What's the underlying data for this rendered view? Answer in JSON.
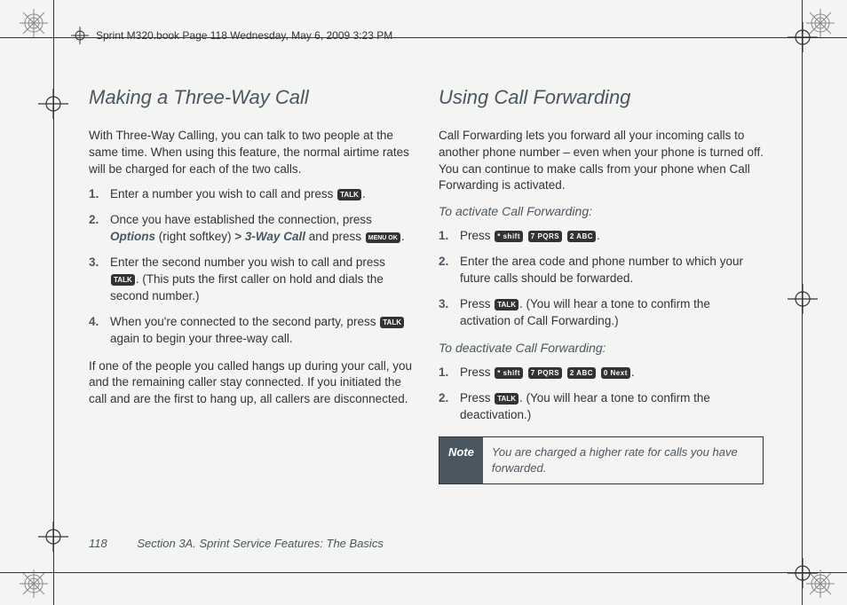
{
  "header_strip": "Sprint M320.book  Page 118  Wednesday, May 6, 2009  3:23 PM",
  "left": {
    "title": "Making a Three-Way Call",
    "intro": "With Three-Way Calling, you can talk to two people at the same time. When using this feature, the normal airtime rates will be charged for each of the two calls.",
    "step1_a": "Enter a number you wish to call and press ",
    "step1_b": ".",
    "step2_a": "Once you have established the connection, press ",
    "step2_options": "Options",
    "step2_b": " (right softkey) ",
    "step2_gt": ">",
    "step2_3way": " 3-Way Call",
    "step2_c": " and press ",
    "step2_d": ".",
    "step3_a": "Enter the second number you wish to call and press ",
    "step3_b": ". (This puts the first caller on hold and dials the second number.)",
    "step4_a": "When you're connected to the second party, press ",
    "step4_b": " again to begin your three-way call.",
    "outro": "If one of the people you called hangs up during your call, you and the remaining caller stay connected. If you initiated the call and are the first to hang up, all callers are disconnected."
  },
  "right": {
    "title": "Using Call Forwarding",
    "intro": "Call Forwarding lets you forward all your incoming calls to another phone number – even when your phone is turned off. You can continue to make calls from your phone when Call Forwarding is activated.",
    "activate_head": "To activate Call Forwarding:",
    "act1_a": "Press ",
    "act1_b": ".",
    "act2": "Enter the area code and phone number to which your future calls should be forwarded.",
    "act3_a": "Press ",
    "act3_b": ". (You will hear a tone to confirm the activation of Call Forwarding.)",
    "deactivate_head": "To deactivate Call Forwarding:",
    "de1_a": "Press ",
    "de1_b": ".",
    "de2_a": "Press ",
    "de2_b": ". (You will hear a tone to confirm the deactivation.)",
    "note_label": "Note",
    "note_text": "You are charged a higher rate for calls you have forwarded."
  },
  "keys": {
    "talk": "TALK",
    "menu_ok": "MENU OK",
    "star": "* shift",
    "k7": "7 PQRS",
    "k2": "2 ABC",
    "k0": "0 Next"
  },
  "footer": {
    "page_num": "118",
    "section": "Section 3A. Sprint Service Features: The Basics"
  }
}
